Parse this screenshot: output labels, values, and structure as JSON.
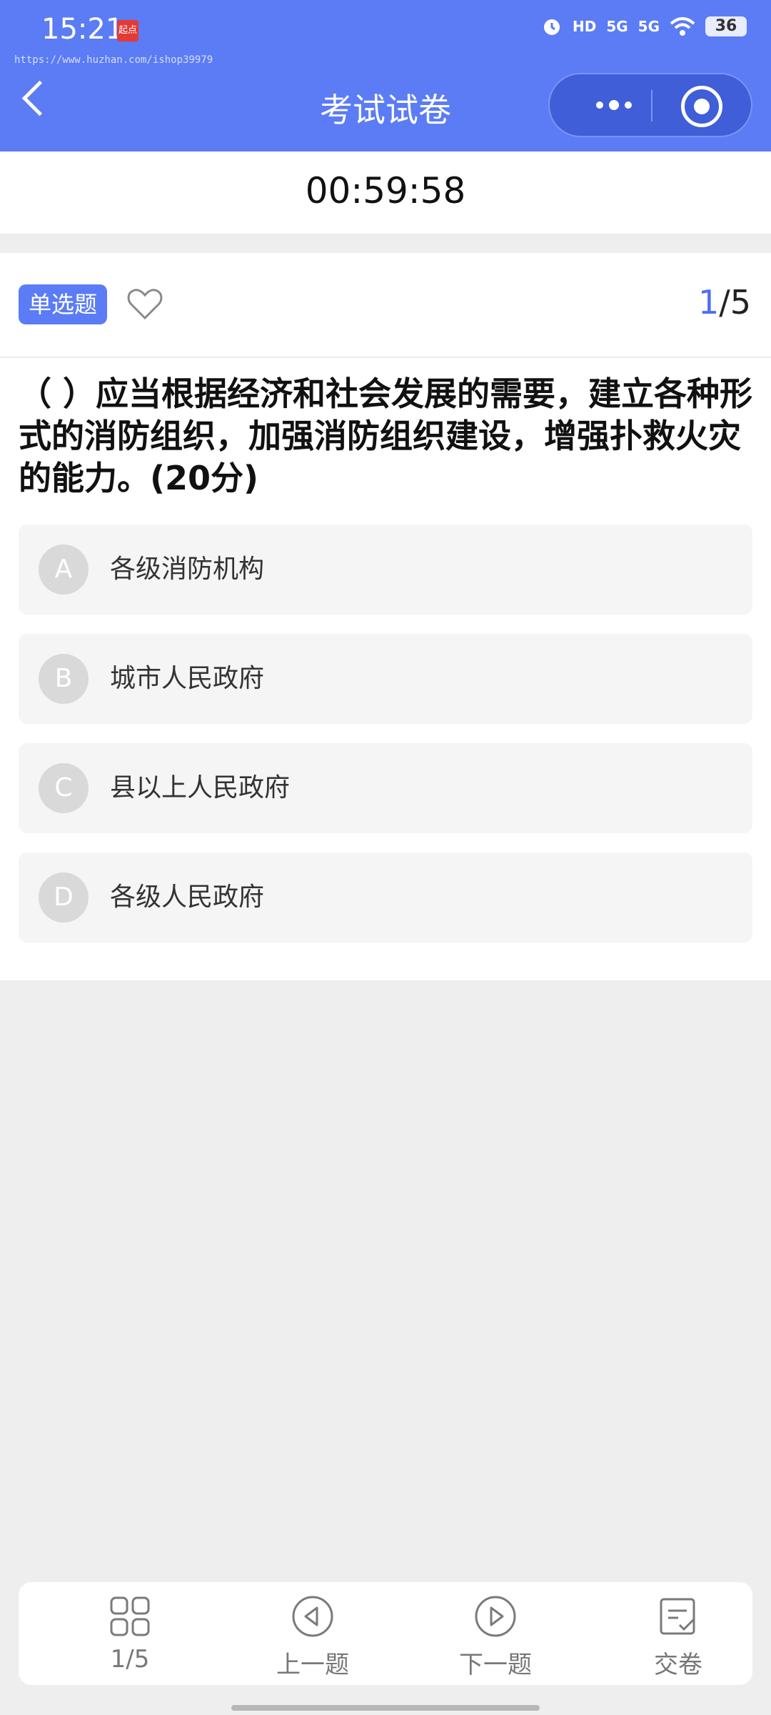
{
  "status_bar": {
    "time": "15:21",
    "app_badge": "起点",
    "watermark": "https://www.huzhan.com/ishop39979",
    "signal_hd": "HD",
    "signal_5g_1": "5G",
    "signal_5g_2": "5G",
    "battery": "36"
  },
  "header": {
    "title": "考试试卷",
    "accent_color": "#5b7cf5"
  },
  "timer": "00:59:58",
  "question": {
    "type_label": "单选题",
    "progress_current": "1",
    "progress_total": "/5",
    "text": "（ ）应当根据经济和社会发展的需要，建立各种形式的消防组织，加强消防组织建设，增强扑救火灾的能力。(20分)",
    "options": [
      {
        "letter": "A",
        "text": "各级消防机构"
      },
      {
        "letter": "B",
        "text": "城市人民政府"
      },
      {
        "letter": "C",
        "text": "县以上人民政府"
      },
      {
        "letter": "D",
        "text": "各级人民政府"
      }
    ]
  },
  "bottom_nav": {
    "items": [
      {
        "label": "1/5",
        "icon": "grid-icon"
      },
      {
        "label": "上一题",
        "icon": "previous-icon"
      },
      {
        "label": "下一题",
        "icon": "next-icon"
      },
      {
        "label": "交卷",
        "icon": "submit-icon"
      }
    ]
  }
}
